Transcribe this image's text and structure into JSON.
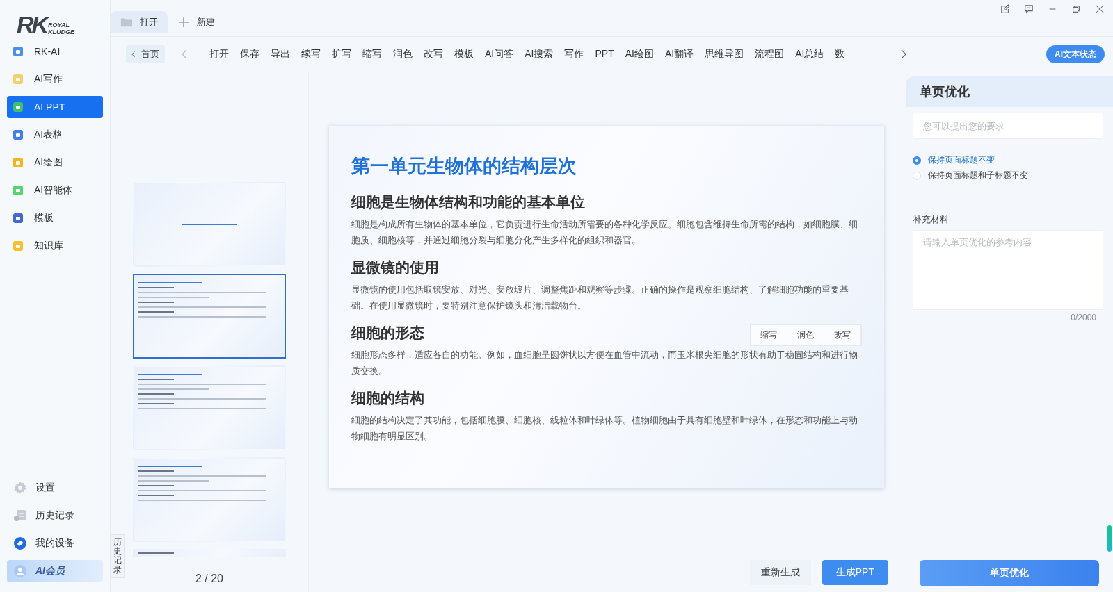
{
  "logo": {
    "mark": "RK",
    "brand_top": "ROYAL",
    "brand_bottom": "KLUDGE"
  },
  "sidebar": {
    "items": [
      {
        "label": "RK-AI",
        "selected": false,
        "color": "#4a8fe8"
      },
      {
        "label": "AI写作",
        "selected": false,
        "color": "#f5cf6a"
      },
      {
        "label": "AI PPT",
        "selected": true,
        "color": "#3cc26c"
      },
      {
        "label": "AI表格",
        "selected": false,
        "color": "#3f7fe6"
      },
      {
        "label": "AI绘图",
        "selected": false,
        "color": "#f2b51d"
      },
      {
        "label": "AI智能体",
        "selected": false,
        "color": "#57d46e"
      },
      {
        "label": "模板",
        "selected": false,
        "color": "#4569d4"
      },
      {
        "label": "知识库",
        "selected": false,
        "color": "#f5c030"
      }
    ],
    "bottom": [
      {
        "kind": "settings",
        "label": "设置"
      },
      {
        "kind": "history",
        "label": "历史记录"
      },
      {
        "kind": "device",
        "label": "我的设备"
      },
      {
        "kind": "member",
        "label": "AI会员"
      }
    ]
  },
  "file_tabs": [
    {
      "kind": "open",
      "label": "打开",
      "selected": true
    },
    {
      "kind": "new",
      "label": "新建",
      "selected": false
    }
  ],
  "toolbar": {
    "home": "首页",
    "items": [
      "打开",
      "保存",
      "导出",
      "续写",
      "扩写",
      "缩写",
      "润色",
      "改写",
      "模板",
      "AI问答",
      "AI搜索",
      "写作",
      "PPT",
      "AI绘图",
      "AI翻译",
      "思维导图",
      "流程图",
      "AI总结",
      "数"
    ],
    "status_button": "AI文本状态"
  },
  "history_tab": "历史记录",
  "thumbnails": [
    {
      "kind": "title",
      "selected": false
    },
    {
      "kind": "content",
      "selected": true
    },
    {
      "kind": "content",
      "selected": false
    },
    {
      "kind": "content",
      "selected": false
    },
    {
      "kind": "partial",
      "selected": false
    }
  ],
  "page_counter": "2 / 20",
  "slide": {
    "title": "第一单元生物体的结构层次",
    "sections": [
      {
        "heading": "细胞是生物体结构和功能的基本单位",
        "body": "细胞是构成所有生物体的基本单位，它负责进行生命活动所需要的各种化学反应。细胞包含维持生命所需的结构，如细胞膜、细胞质、细胞核等，并通过细胞分裂与细胞分化产生多样化的组织和器官。"
      },
      {
        "heading": "显微镜的使用",
        "body": "显微镜的使用包括取镜安放、对光、安放玻片、调整焦距和观察等步骤。正确的操作是观察细胞结构、了解细胞功能的重要基础。在使用显微镜时，要特别注意保护镜头和清洁载物台。"
      },
      {
        "heading": "细胞的形态",
        "body": "细胞形态多样，适应各自的功能。例如，血细胞呈圆饼状以方便在血管中流动，而玉米根尖细胞的形状有助于稳固结构和进行物质交换。",
        "actions": [
          "缩写",
          "润色",
          "改写"
        ]
      },
      {
        "heading": "细胞的结构",
        "body": "细胞的结构决定了其功能，包括细胞膜、细胞核、线粒体和叶绿体等。植物细胞由于具有细胞壁和叶绿体，在形态和功能上与动物细胞有明显区别。"
      }
    ]
  },
  "bottom_buttons": {
    "regenerate": "重新生成",
    "generate": "生成PPT"
  },
  "panel": {
    "title": "单页优化",
    "request_placeholder": "您可以提出您的要求",
    "options": [
      {
        "label": "保持页面标题不变",
        "selected": true
      },
      {
        "label": "保持页面标题和子标题不变",
        "selected": false
      }
    ],
    "material_label": "补充材料",
    "material_placeholder": "请输入单页优化的参考内容",
    "counter": "0/2000",
    "submit": "单页优化"
  }
}
